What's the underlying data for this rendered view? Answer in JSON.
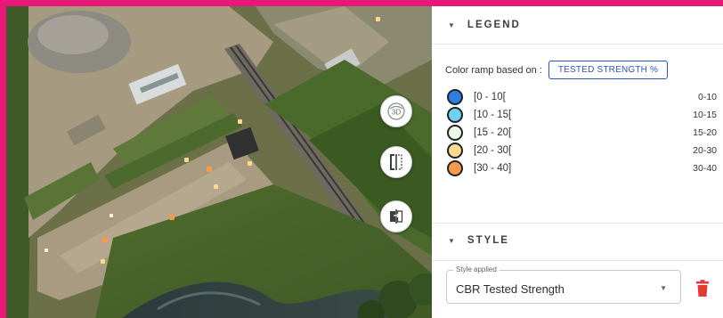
{
  "map": {
    "controls": [
      {
        "name": "toggle-3d-button",
        "icon": "3d-view-icon",
        "label": "3D"
      },
      {
        "name": "compare-split-button",
        "icon": "split-compare-icon"
      },
      {
        "name": "layer-swap-button",
        "icon": "layer-swap-icon"
      }
    ],
    "sample_colors": [
      "#f59a4c",
      "#fbd98e",
      "#eef8ea"
    ]
  },
  "legend": {
    "title": "LEGEND",
    "ramp_label": "Color ramp based on :",
    "ramp_value": "TESTED STRENGTH %",
    "items": [
      {
        "label": "[0 - 10[",
        "range": "0-10",
        "color": "#2f7de0"
      },
      {
        "label": "[10 - 15[",
        "range": "10-15",
        "color": "#6fd0ef"
      },
      {
        "label": "[15 - 20[",
        "range": "15-20",
        "color": "#edf7e8"
      },
      {
        "label": "[20 - 30[",
        "range": "20-30",
        "color": "#fbd98e"
      },
      {
        "label": "[30 - 40]",
        "range": "30-40",
        "color": "#f59a4c"
      }
    ]
  },
  "style": {
    "title": "STYLE",
    "field_label": "Style applied",
    "field_value": "CBR Tested Strength",
    "delete_icon": "trash-icon",
    "delete_color": "#e53935"
  },
  "frame": {
    "border_color": "#e8177a"
  }
}
